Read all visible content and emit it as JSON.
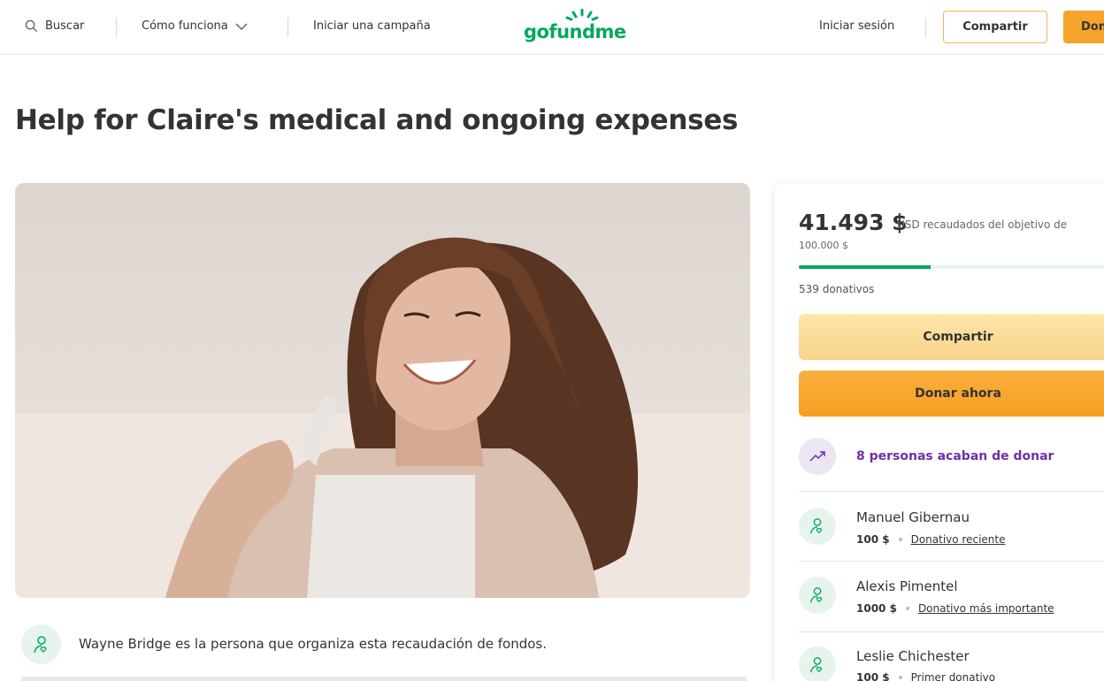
{
  "header": {
    "search_label": "Buscar",
    "how_label": "Cómo funciona",
    "start_label": "Iniciar una campaña",
    "logo_text": "gofundme",
    "login_label": "Iniciar sesión",
    "share_label": "Compartir",
    "donate_label": "Dona"
  },
  "campaign": {
    "title": "Help for Claire's medical and ongoing expenses",
    "organizer_text": "Wayne Bridge es la persona que organiza esta recaudación de fondos."
  },
  "card": {
    "raised_amount": "41.493 $",
    "raised_suffix": "USD recaudados del objetivo de",
    "goal": "100.000 $",
    "progress_fraction": 0.41493,
    "donations_count": "539 donativos",
    "share_label": "Compartir",
    "donate_label": "Donar ahora",
    "trend_text": "8 personas acaban de donar",
    "donors": [
      {
        "name": "Manuel Gibernau",
        "amount": "100 $",
        "tag": "Donativo reciente"
      },
      {
        "name": "Alexis Pimentel",
        "amount": "1000 $",
        "tag": "Donativo más importante"
      },
      {
        "name": "Leslie Chichester",
        "amount": "100 $",
        "tag": "Primer donativo"
      }
    ]
  },
  "colors": {
    "brand_green": "#02a95c",
    "donate_orange": "#f69e21",
    "share_yellow": "#fad389",
    "trend_purple": "#6f2fa6"
  }
}
